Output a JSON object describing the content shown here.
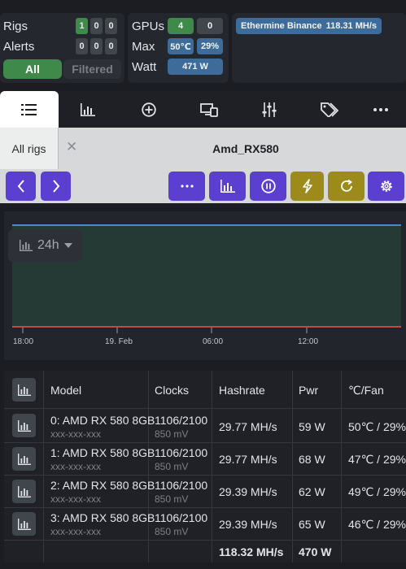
{
  "summary": {
    "rigs": {
      "label": "Rigs",
      "counts": [
        "1",
        "0",
        "0"
      ]
    },
    "alerts": {
      "label": "Alerts",
      "counts": [
        "0",
        "0",
        "0"
      ]
    },
    "filter": {
      "all": "All",
      "filtered": "Filtered"
    },
    "gpus": {
      "label": "GPUs",
      "ok": "4",
      "bad": "0"
    },
    "max": {
      "label": "Max",
      "temp": "50℃",
      "fan": "29%"
    },
    "watt": {
      "label": "Watt",
      "value": "471 W"
    },
    "pool": {
      "name": "Ethermine Binance",
      "hashrate": "118.31 MH/s"
    }
  },
  "tabs": [
    {
      "icon": "list-icon",
      "active": true
    },
    {
      "icon": "bar-chart-icon",
      "active": false
    },
    {
      "icon": "plus-circle-icon",
      "active": false
    },
    {
      "icon": "devices-icon",
      "active": false
    },
    {
      "icon": "sliders-icon",
      "active": false
    },
    {
      "icon": "tags-icon",
      "active": false
    },
    {
      "icon": "more-icon",
      "active": false
    }
  ],
  "rig_header": {
    "all_rigs": "All rigs",
    "close": "✕",
    "rig_name": "Amd_RX580"
  },
  "chart": {
    "range_label": "24h",
    "x_ticks": [
      "18:00",
      "19. Feb",
      "06:00",
      "12:00"
    ],
    "line_colors": {
      "hashrate": "#4b86d6",
      "temp": "#c94a3c"
    }
  },
  "table": {
    "headers": {
      "model": "Model",
      "clocks": "Clocks",
      "hashrate": "Hashrate",
      "pwr": "Pwr",
      "temp_fan": "℃/Fan"
    },
    "rows": [
      {
        "model": "0: AMD RX 580 8GB",
        "id": "xxx-xxx-xxx",
        "clocks": "1106/2100",
        "volt": "850 mV",
        "hashrate": "29.77 MH/s",
        "pwr": "59 W",
        "temp_fan": "50℃ / 29%"
      },
      {
        "model": "1: AMD RX 580 8GB",
        "id": "xxx-xxx-xxx",
        "clocks": "1106/2100",
        "volt": "850 mV",
        "hashrate": "29.77 MH/s",
        "pwr": "68 W",
        "temp_fan": "47℃ / 29%"
      },
      {
        "model": "2: AMD RX 580 8GB",
        "id": "xxx-xxx-xxx",
        "clocks": "1106/2100",
        "volt": "850 mV",
        "hashrate": "29.39 MH/s",
        "pwr": "62 W",
        "temp_fan": "49℃ / 29%"
      },
      {
        "model": "3: AMD RX 580 8GB",
        "id": "xxx-xxx-xxx",
        "clocks": "1106/2100",
        "volt": "850 mV",
        "hashrate": "29.39 MH/s",
        "pwr": "65 W",
        "temp_fan": "46℃ / 29%"
      }
    ],
    "totals": {
      "hashrate": "118.32 MH/s",
      "pwr": "470 W"
    }
  }
}
